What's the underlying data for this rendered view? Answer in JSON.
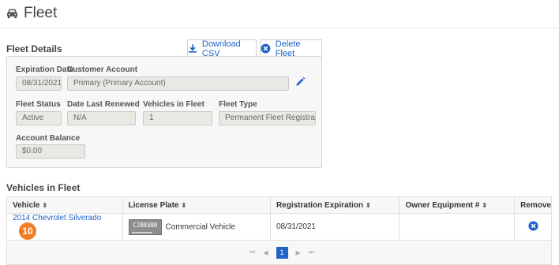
{
  "page": {
    "title": "Fleet",
    "icon": "car-icon"
  },
  "fleet_details": {
    "title": "Fleet Details",
    "download_csv": "Download CSV",
    "delete_fleet": "Delete Fleet",
    "fields": {
      "expiration_date": {
        "label": "Expiration Date",
        "value": "08/31/2021"
      },
      "customer_account": {
        "label": "Customer Account",
        "value": "Primary (Primary Account)"
      },
      "fleet_status": {
        "label": "Fleet Status",
        "value": "Active"
      },
      "date_last_renewed": {
        "label": "Date Last Renewed",
        "value": "N/A"
      },
      "vehicles_in_fleet": {
        "label": "Vehicles in Fleet",
        "value": "1"
      },
      "fleet_type": {
        "label": "Fleet Type",
        "value": "Permanent Fleet Registration"
      },
      "account_balance": {
        "label": "Account Balance",
        "value": "$0.00"
      }
    }
  },
  "vehicles": {
    "title": "Vehicles in Fleet",
    "columns": [
      "Vehicle",
      "License Plate",
      "Registration Expiration",
      "Owner Equipment #",
      "Remove"
    ],
    "rows": [
      {
        "vehicle": "2014 Chevrolet Silverado",
        "badge": "10",
        "plate_text": "CJ84580",
        "plate_type": "Commercial Vehicle",
        "registration_expiration": "08/31/2021",
        "owner_equipment": ""
      }
    ],
    "pager": {
      "current_page": "1",
      "first": "⏮",
      "prev": "◀",
      "next": "▶",
      "last": "⏭"
    }
  },
  "colors": {
    "link": "#1f63c8",
    "badge": "#f07e26",
    "box_bg": "#f7f7f7"
  }
}
